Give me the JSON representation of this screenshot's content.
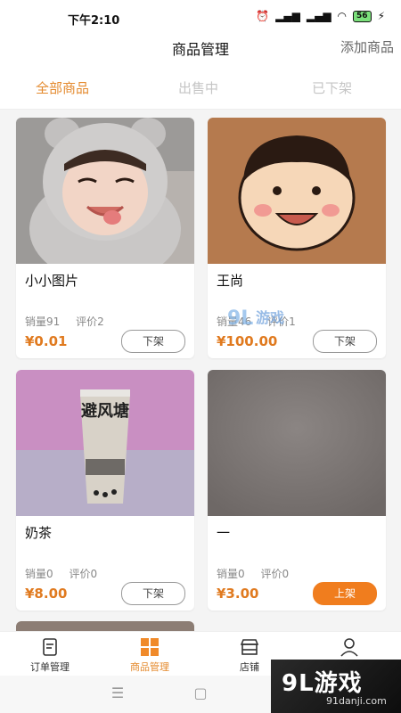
{
  "status_bar": {
    "time": "下午2:10",
    "battery": "56"
  },
  "header": {
    "title": "商品管理",
    "add_button": "添加商品"
  },
  "tabs": [
    {
      "label": "全部商品",
      "active": true
    },
    {
      "label": "出售中",
      "active": false
    },
    {
      "label": "已下架",
      "active": false
    }
  ],
  "products": [
    {
      "name": "小小图片",
      "sales": "销量91",
      "reviews": "评价2",
      "price": "¥0.01",
      "action": "下架",
      "image": "baby-in-bear-hood"
    },
    {
      "name": "王尚",
      "sales": "销量46",
      "reviews": "评价1",
      "price": "¥100.00",
      "action": "下架",
      "image": "cartoon-boy-face"
    },
    {
      "name": "奶茶",
      "sales": "销量0",
      "reviews": "评价0",
      "price": "¥8.00",
      "action": "下架",
      "image": "bubble-milk-tea-cup"
    },
    {
      "name": "一",
      "sales": "销量0",
      "reviews": "评价0",
      "price": "¥3.00",
      "action": "上架",
      "image": "plain-gray-texture"
    }
  ],
  "cup_text": "避风塘",
  "tab_bar": [
    {
      "label": "订单管理",
      "icon": "order-icon",
      "active": false
    },
    {
      "label": "商品管理",
      "icon": "grid-icon",
      "active": true
    },
    {
      "label": "店铺",
      "icon": "store-icon",
      "active": false
    },
    {
      "label": "我的",
      "icon": "user-icon",
      "active": false
    }
  ],
  "watermark": {
    "main": "9L游戏",
    "sub": "91danji.com"
  },
  "colors": {
    "accent": "#e48a2e",
    "button_primary": "#f07d1e",
    "price": "#e07a1f"
  }
}
